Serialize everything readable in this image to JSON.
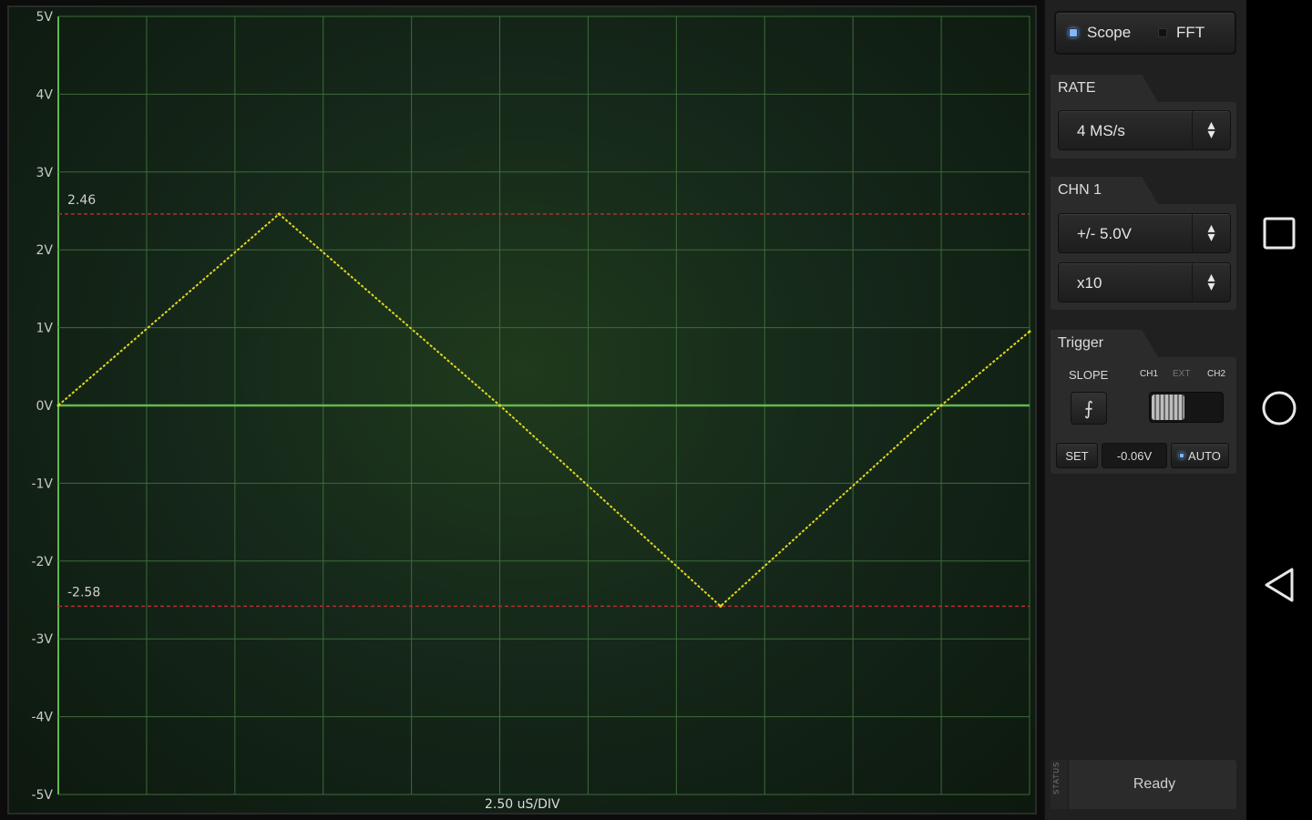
{
  "scope": {
    "y_labels": [
      "5V",
      "4V",
      "3V",
      "2V",
      "1V",
      "0V",
      "-1V",
      "-2V",
      "-3V",
      "-4V",
      "-5V"
    ],
    "time_div_label": "2.50 uS/DIV",
    "cursor_high_label": "2.46",
    "cursor_low_label": "-2.58",
    "colors": {
      "trace": "#e0d820",
      "grid": "#3d6b3a",
      "zero_line": "#63b84e",
      "cursor": "#b03030"
    }
  },
  "chart_data": {
    "type": "line",
    "title": "",
    "xlabel": "2.50 uS/DIV",
    "ylabel": "",
    "ylim": [
      -5,
      5
    ],
    "xlim": [
      0,
      11
    ],
    "grid": true,
    "x_divisions": 11,
    "series": [
      {
        "x": [
          0,
          2.5,
          5.0,
          7.5,
          10.0,
          11.0
        ],
        "values": [
          0,
          2.46,
          0,
          -2.58,
          0,
          0.95
        ]
      }
    ],
    "cursors": [
      2.46,
      -2.58
    ]
  },
  "panel": {
    "mode": {
      "scope_label": "Scope",
      "fft_label": "FFT",
      "selected": "Scope"
    },
    "rate": {
      "title": "RATE",
      "value": "4 MS/s"
    },
    "chn1": {
      "title": "CHN 1",
      "range": "+/- 5.0V",
      "probe": "x10"
    },
    "trigger": {
      "title": "Trigger",
      "slope_label": "SLOPE",
      "src_ch1": "CH1",
      "src_ext": "EXT",
      "src_ch2": "CH2",
      "set_label": "SET",
      "level_value": "-0.06V",
      "auto_label": "AUTO",
      "auto_on": true
    },
    "status": {
      "tag": "STATUS",
      "text": "Ready"
    }
  },
  "nav": {
    "recents": "square-icon",
    "home": "circle-icon",
    "back": "triangle-icon"
  }
}
